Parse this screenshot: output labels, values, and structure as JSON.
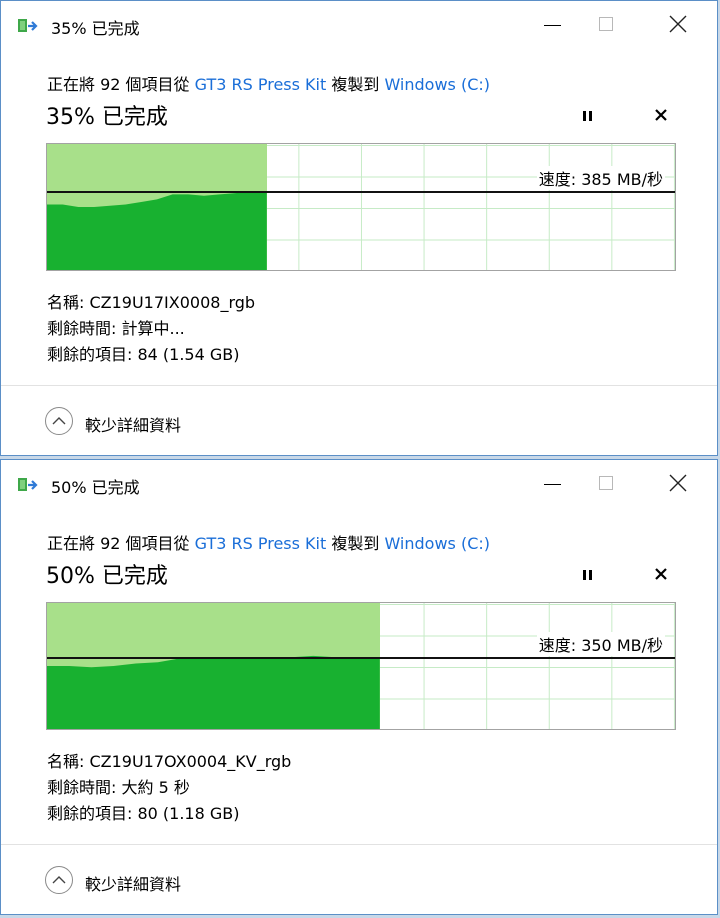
{
  "dialogs": [
    {
      "window_title": "35% 已完成",
      "copy_prefix": "正在將 92 個項目從 ",
      "source": "GT3 RS Press Kit",
      "copy_middle": " 複製到 ",
      "destination": "Windows (C:)",
      "percent_complete_text": "35% 已完成",
      "progress": 0.35,
      "speed_text": "速度: 385 MB/秒",
      "speed_level": 0.62,
      "throughput_history": [
        0.52,
        0.52,
        0.5,
        0.5,
        0.51,
        0.52,
        0.54,
        0.56,
        0.6,
        0.6,
        0.59,
        0.6,
        0.61,
        0.62,
        0.62
      ],
      "name_text": "名稱: CZ19U17IX0008_rgb",
      "time_remaining_text": "剩餘時間: 計算中...",
      "items_remaining_text": "剩餘的項目: 84 (1.54 GB)",
      "fewer_details_label": "較少詳細資料"
    },
    {
      "window_title": "50% 已完成",
      "copy_prefix": "正在將 92 個項目從 ",
      "source": "GT3 RS Press Kit",
      "copy_middle": " 複製到 ",
      "destination": "Windows (C:)",
      "percent_complete_text": "50% 已完成",
      "progress": 0.53,
      "speed_text": "速度: 350 MB/秒",
      "speed_level": 0.56,
      "throughput_history": [
        0.5,
        0.5,
        0.49,
        0.5,
        0.52,
        0.53,
        0.56,
        0.56,
        0.57,
        0.57,
        0.56,
        0.57,
        0.58,
        0.57,
        0.56,
        0.56
      ],
      "name_text": "名稱: CZ19U17OX0004_KV_rgb",
      "time_remaining_text": "剩餘時間: 大約 5 秒",
      "items_remaining_text": "剩餘的項目: 80 (1.18 GB)",
      "fewer_details_label": "較少詳細資料"
    }
  ],
  "colors": {
    "graph_light": "#a8e08a",
    "graph_dark": "#18b130",
    "link": "#1a6ed8"
  },
  "icons": {
    "app": "copy-files-icon",
    "pause": "pause-icon",
    "cancel": "close-icon",
    "details": "chevron-up-icon"
  }
}
